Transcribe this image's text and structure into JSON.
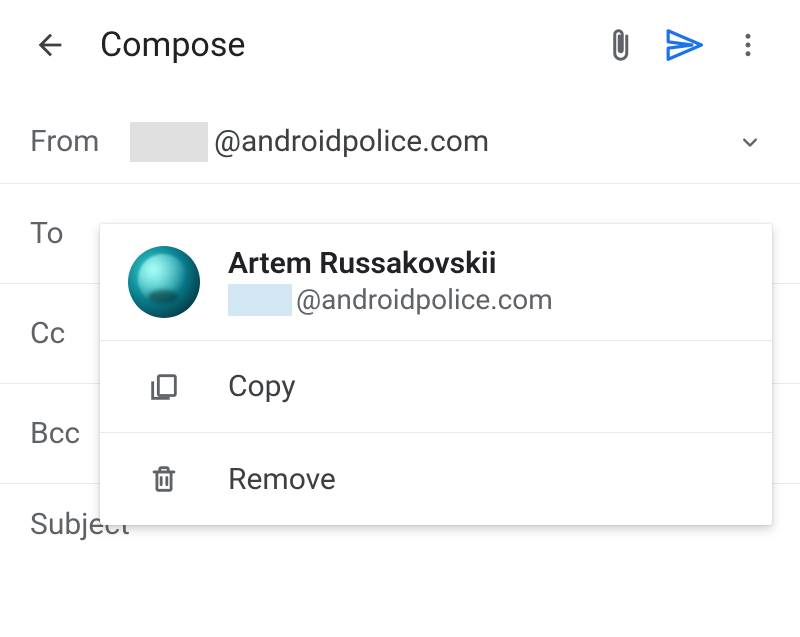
{
  "appbar": {
    "title": "Compose"
  },
  "fields": {
    "from_label": "From",
    "from_domain": "@androidpolice.com",
    "to_label": "To",
    "cc_label": "Cc",
    "bcc_label": "Bcc",
    "subject_label": "Subject"
  },
  "popup": {
    "contact_name": "Artem Russakovskii",
    "contact_domain": "@androidpolice.com",
    "copy_label": "Copy",
    "remove_label": "Remove"
  }
}
